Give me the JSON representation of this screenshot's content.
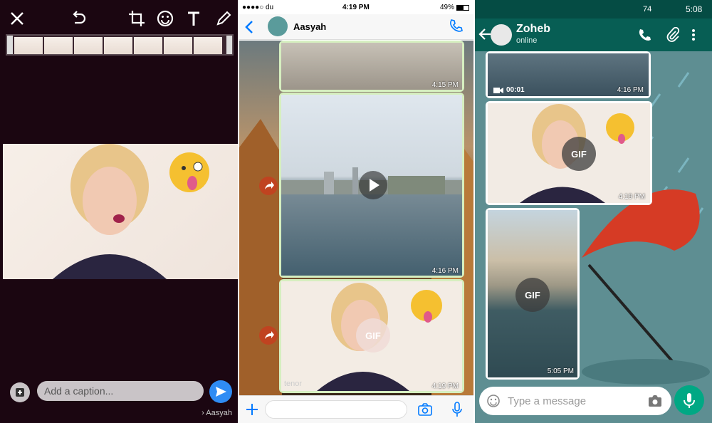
{
  "panel1": {
    "caption_placeholder": "Add a caption...",
    "recipient": "Aasyah",
    "icons": [
      "close-icon",
      "undo-icon",
      "crop-icon",
      "emoji-icon",
      "text-icon",
      "pencil-icon"
    ]
  },
  "panel2": {
    "status": {
      "carrier": "●●●●○ du",
      "time": "4:19 PM",
      "battery": "49%"
    },
    "contact_name": "Aasyah",
    "messages": [
      {
        "time": "4:15 PM"
      },
      {
        "time": "4:16 PM"
      },
      {
        "time": "4:19 PM",
        "badge": "GIF",
        "watermark": "tenor"
      }
    ]
  },
  "panel3": {
    "status": {
      "signal": "74",
      "time": "5:08"
    },
    "contact_name": "Zoheb",
    "contact_status": "online",
    "messages": [
      {
        "duration": "00:01",
        "time": "4:16 PM"
      },
      {
        "badge": "GIF",
        "time": "4:19 PM"
      },
      {
        "badge": "GIF",
        "time": "5:05 PM"
      }
    ],
    "input_placeholder": "Type a message"
  },
  "colors": {
    "whatsapp_teal": "#075e54",
    "send_blue": "#2f8cf4",
    "mic_green": "#00a884",
    "ios_blue": "#007aff"
  }
}
